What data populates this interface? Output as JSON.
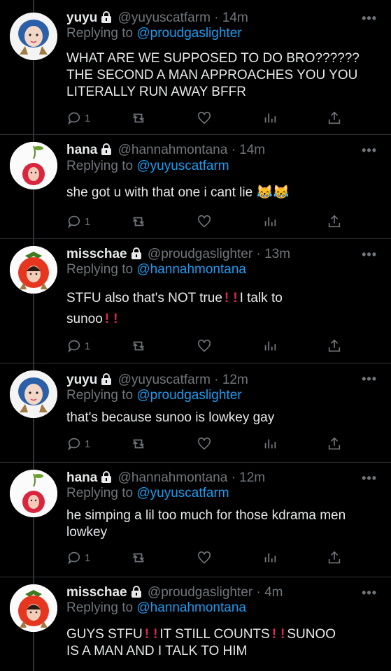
{
  "tweets": [
    {
      "name": "yuyu",
      "handle": "@yuyuscatfarm",
      "time": "14m",
      "replying_prefix": "Replying to ",
      "replying_to": "@proudgaslighter",
      "text": "WHAT ARE WE SUPPOSED TO DO BRO?????? THE SECOND A MAN APPROACHES YOU YOU LITERALLY RUN AWAY BFFR",
      "reply_count": "1",
      "avatar": "blue-hair-girl"
    },
    {
      "name": "hana",
      "handle": "@hannahmontana",
      "time": "14m",
      "replying_prefix": "Replying to ",
      "replying_to": "@yuyuscatfarm",
      "text": "she got u with that one i cant lie 😹😹",
      "reply_count": "1",
      "avatar": "cherry-girl"
    },
    {
      "name": "misschae",
      "handle": "@proudgaslighter",
      "time": "13m",
      "replying_prefix": "Replying to ",
      "replying_to": "@hannahmontana",
      "text_parts": [
        "STFU also that's NOT true",
        "!",
        "!",
        "I talk to",
        "sunoo",
        "!",
        "!"
      ],
      "reply_count": "1",
      "avatar": "strawberry-girl"
    },
    {
      "name": "yuyu",
      "handle": "@yuyuscatfarm",
      "time": "12m",
      "replying_prefix": "Replying to ",
      "replying_to": "@proudgaslighter",
      "text": "that's because sunoo is lowkey gay",
      "reply_count": "1",
      "avatar": "blue-hair-girl"
    },
    {
      "name": "hana",
      "handle": "@hannahmontana",
      "time": "12m",
      "replying_prefix": "Replying to ",
      "replying_to": "@yuyuscatfarm",
      "text": "he simping a lil too much for those kdrama men lowkey",
      "reply_count": "1",
      "avatar": "cherry-girl"
    },
    {
      "name": "misschae",
      "handle": "@proudgaslighter",
      "time": "4m",
      "replying_prefix": "Replying to ",
      "replying_to": "@hannahmontana",
      "text_parts": [
        "GUYS STFU",
        "!",
        "!",
        "IT STILL COUNTS",
        "!",
        "!",
        "SUNOO",
        "IS A MAN AND I TALK TO HIM"
      ],
      "avatar": "strawberry-girl"
    }
  ],
  "separator": "·",
  "more_label": "•••",
  "colors": {
    "background": "#000000",
    "link": "#1d9bf0",
    "muted": "#71767b",
    "text": "#e7e9ea",
    "exclamation": "#e0245e"
  },
  "icons": [
    "lock-icon",
    "reply-icon",
    "retweet-icon",
    "like-icon",
    "analytics-icon",
    "share-icon",
    "more-icon"
  ]
}
